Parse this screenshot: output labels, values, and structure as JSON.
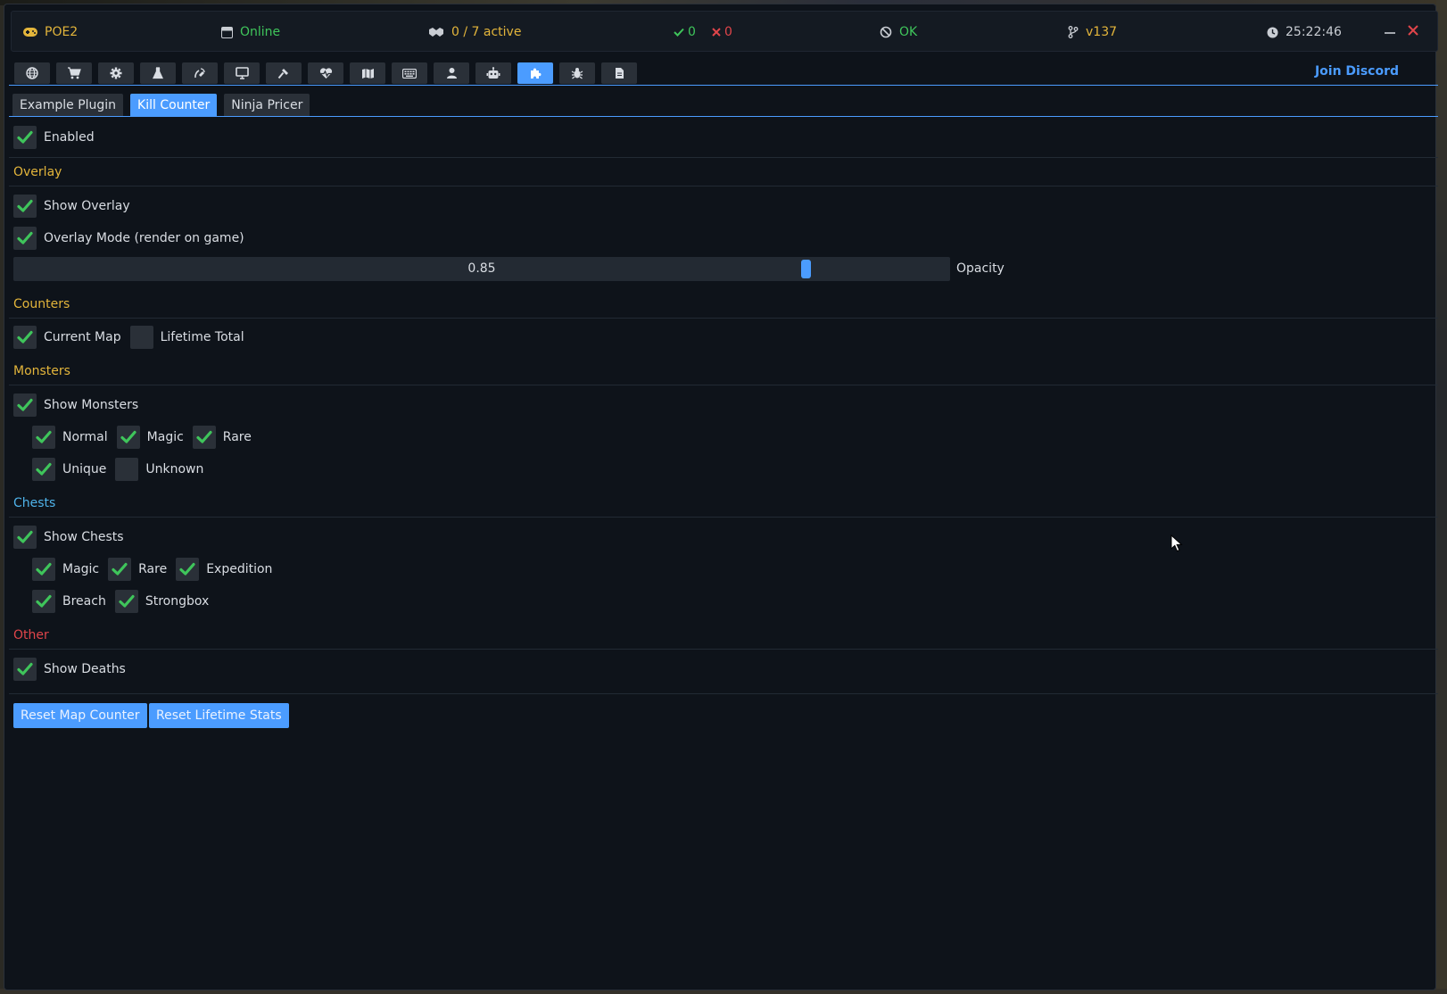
{
  "titlebar": {
    "game": "POE2",
    "connection": "Online",
    "active": "0 / 7 active",
    "ok_count": "0",
    "err_count": "0",
    "status": "OK",
    "version": "v137",
    "clock": "25:22:46"
  },
  "toolbar": {
    "icons": [
      "globe-icon",
      "cart-icon",
      "gear-icon",
      "flask-icon",
      "satellite-icon",
      "monitor-icon",
      "hammer-icon",
      "heartbeat-icon",
      "map-icon",
      "keyboard-icon",
      "user-icon",
      "robot-icon",
      "puzzle-icon",
      "bug-icon",
      "file-icon"
    ],
    "active_icon": "puzzle-icon",
    "discord": "Join Discord"
  },
  "plugin_tabs": [
    "Example Plugin",
    "Kill Counter",
    "Ninja Pricer"
  ],
  "active_tab": "Kill Counter",
  "settings": {
    "enabled": "Enabled",
    "overlay": {
      "title": "Overlay",
      "show_overlay": "Show Overlay",
      "overlay_mode": "Overlay Mode (render on game)",
      "opacity_value": "0.85",
      "opacity_fraction": 0.85,
      "opacity_label": "Opacity"
    },
    "counters": {
      "title": "Counters",
      "current_map": "Current Map",
      "lifetime_total": "Lifetime Total"
    },
    "monsters": {
      "title": "Monsters",
      "show": "Show Monsters",
      "normal": "Normal",
      "magic": "Magic",
      "rare": "Rare",
      "unique": "Unique",
      "unknown": "Unknown"
    },
    "chests": {
      "title": "Chests",
      "show": "Show Chests",
      "magic": "Magic",
      "rare": "Rare",
      "expedition": "Expedition",
      "breach": "Breach",
      "strongbox": "Strongbox"
    },
    "other": {
      "title": "Other",
      "show_deaths": "Show Deaths"
    }
  },
  "buttons": {
    "reset_map": "Reset Map Counter",
    "reset_lifetime": "Reset Lifetime Stats"
  },
  "colors": {
    "accent": "#4b9cff",
    "check": "#3fc55b",
    "section_gold": "#e3b53b",
    "section_blue": "#4fb3ea",
    "section_red": "#e0454a"
  }
}
